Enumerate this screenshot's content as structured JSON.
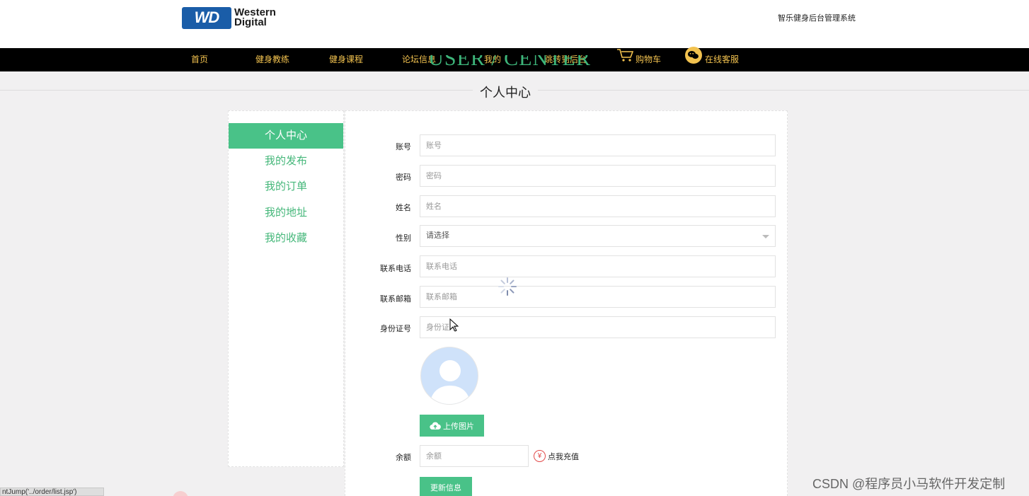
{
  "header": {
    "logo_line1": "Western",
    "logo_line2": "Digital",
    "logo_mark": "WD",
    "system_title": "智乐健身后台管理系统"
  },
  "nav": {
    "items": [
      {
        "label": "首页"
      },
      {
        "label": "健身教练"
      },
      {
        "label": "健身课程"
      },
      {
        "label": "论坛信息"
      },
      {
        "label": "我的"
      },
      {
        "label": "跳转到后台"
      },
      {
        "label": "购物车",
        "icon": "cart-icon"
      },
      {
        "label": "在线客服",
        "icon": "wechat-icon"
      }
    ]
  },
  "page": {
    "bg_title": "USER / CENTER",
    "heading": "个人中心"
  },
  "sidebar": {
    "items": [
      {
        "label": "个人中心",
        "active": true
      },
      {
        "label": "我的发布"
      },
      {
        "label": "我的订单"
      },
      {
        "label": "我的地址"
      },
      {
        "label": "我的收藏"
      }
    ]
  },
  "form": {
    "account": {
      "label": "账号",
      "placeholder": "账号",
      "value": ""
    },
    "password": {
      "label": "密码",
      "placeholder": "密码",
      "value": ""
    },
    "name": {
      "label": "姓名",
      "placeholder": "姓名",
      "value": ""
    },
    "gender": {
      "label": "性别",
      "selected": "请选择"
    },
    "phone": {
      "label": "联系电话",
      "placeholder": "联系电话",
      "value": ""
    },
    "email": {
      "label": "联系邮箱",
      "placeholder": "联系邮箱",
      "value": ""
    },
    "id_card": {
      "label": "身份证号",
      "placeholder": "身份证号",
      "value": ""
    },
    "upload_button": "上传图片",
    "balance": {
      "label": "余额",
      "placeholder": "余额",
      "value": ""
    },
    "recharge_link": "点我充值",
    "update_button": "更新信息"
  },
  "status_bar": {
    "url_text": "ntJump('../order/list.jsp')"
  },
  "watermark": "CSDN @程序员小马软件开发定制",
  "colors": {
    "accent_green": "#49c288",
    "nav_bg": "#000000",
    "nav_text": "#f2c24f",
    "page_bg": "#f1f0f1"
  }
}
